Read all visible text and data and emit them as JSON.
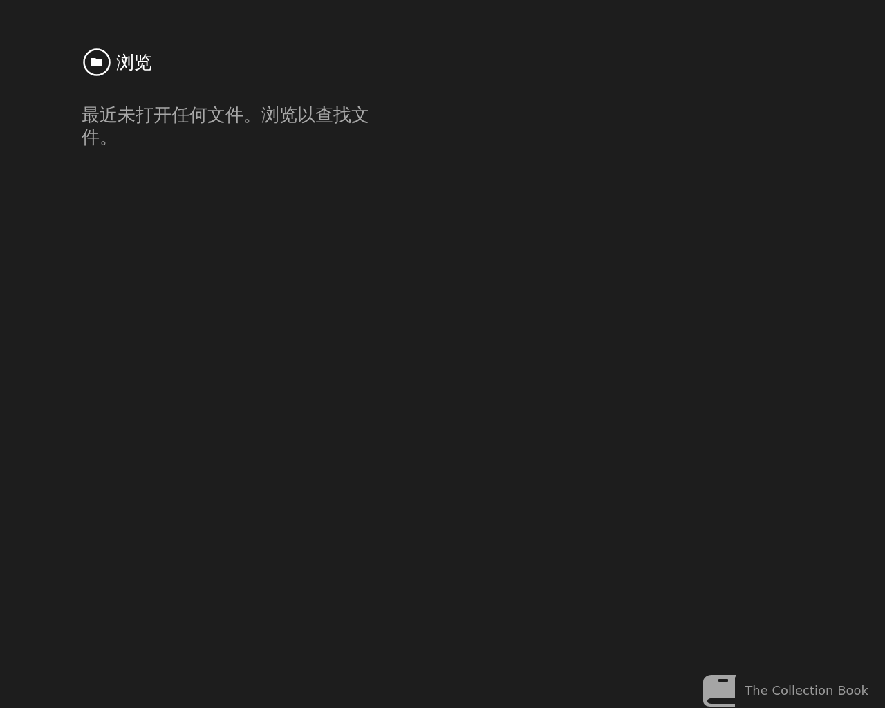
{
  "browse_button": {
    "label": "浏览"
  },
  "message": "最近未打开任何文件。浏览以查找文件。",
  "app_name": "The Collection Book"
}
